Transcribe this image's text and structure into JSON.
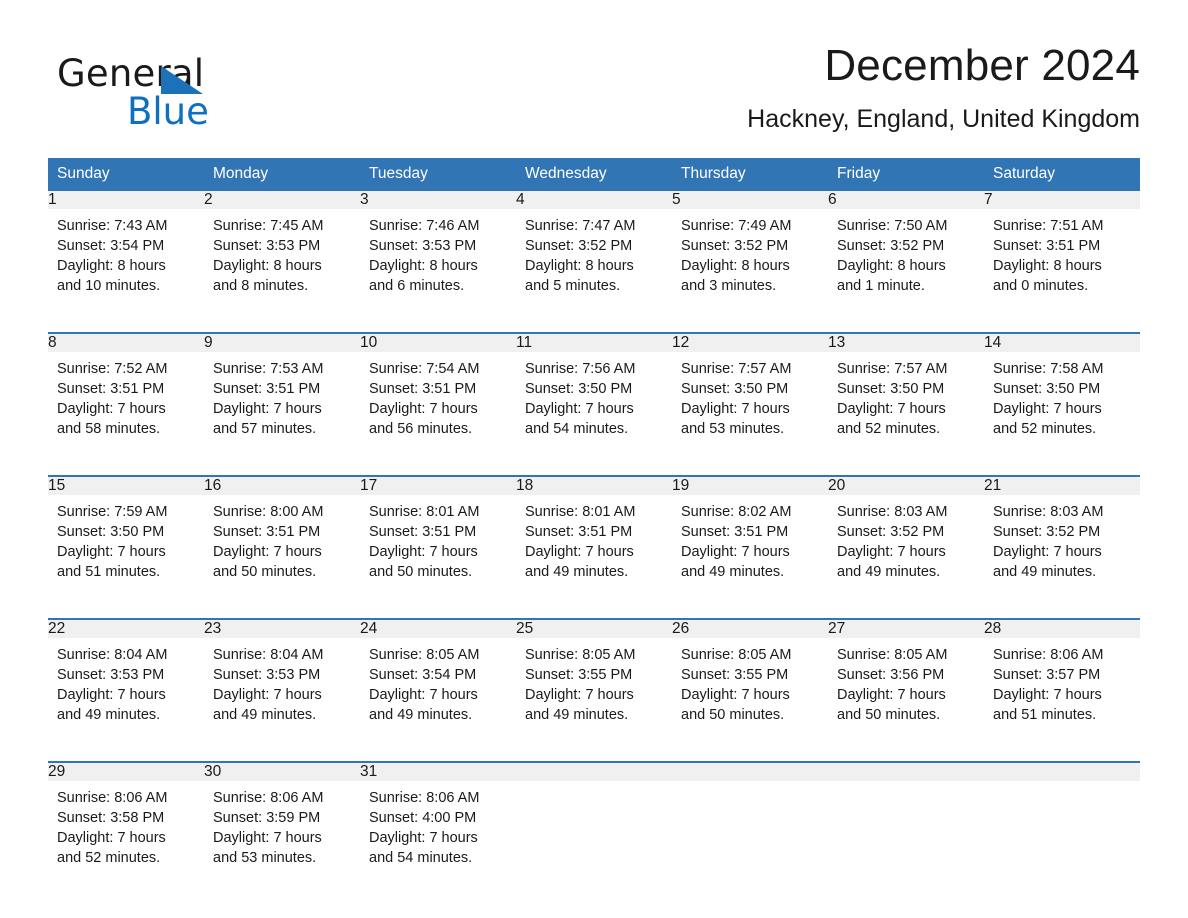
{
  "brand": {
    "name_part1": "General",
    "name_part2": "Blue",
    "triangle_color": "#1c72b8",
    "blue_color": "#0f6fc0"
  },
  "header": {
    "title": "December 2024",
    "subtitle": "Hackney, England, United Kingdom"
  },
  "colors": {
    "header_blue": "#3275b5",
    "daynum_gray": "#f0f0f0",
    "text": "#1a1a1a"
  },
  "calendar": {
    "weekday_headers": [
      "Sunday",
      "Monday",
      "Tuesday",
      "Wednesday",
      "Thursday",
      "Friday",
      "Saturday"
    ],
    "weeks": [
      [
        {
          "day": "1",
          "sunrise": "Sunrise: 7:43 AM",
          "sunset": "Sunset: 3:54 PM",
          "daylight1": "Daylight: 8 hours",
          "daylight2": "and 10 minutes."
        },
        {
          "day": "2",
          "sunrise": "Sunrise: 7:45 AM",
          "sunset": "Sunset: 3:53 PM",
          "daylight1": "Daylight: 8 hours",
          "daylight2": "and 8 minutes."
        },
        {
          "day": "3",
          "sunrise": "Sunrise: 7:46 AM",
          "sunset": "Sunset: 3:53 PM",
          "daylight1": "Daylight: 8 hours",
          "daylight2": "and 6 minutes."
        },
        {
          "day": "4",
          "sunrise": "Sunrise: 7:47 AM",
          "sunset": "Sunset: 3:52 PM",
          "daylight1": "Daylight: 8 hours",
          "daylight2": "and 5 minutes."
        },
        {
          "day": "5",
          "sunrise": "Sunrise: 7:49 AM",
          "sunset": "Sunset: 3:52 PM",
          "daylight1": "Daylight: 8 hours",
          "daylight2": "and 3 minutes."
        },
        {
          "day": "6",
          "sunrise": "Sunrise: 7:50 AM",
          "sunset": "Sunset: 3:52 PM",
          "daylight1": "Daylight: 8 hours",
          "daylight2": "and 1 minute."
        },
        {
          "day": "7",
          "sunrise": "Sunrise: 7:51 AM",
          "sunset": "Sunset: 3:51 PM",
          "daylight1": "Daylight: 8 hours",
          "daylight2": "and 0 minutes."
        }
      ],
      [
        {
          "day": "8",
          "sunrise": "Sunrise: 7:52 AM",
          "sunset": "Sunset: 3:51 PM",
          "daylight1": "Daylight: 7 hours",
          "daylight2": "and 58 minutes."
        },
        {
          "day": "9",
          "sunrise": "Sunrise: 7:53 AM",
          "sunset": "Sunset: 3:51 PM",
          "daylight1": "Daylight: 7 hours",
          "daylight2": "and 57 minutes."
        },
        {
          "day": "10",
          "sunrise": "Sunrise: 7:54 AM",
          "sunset": "Sunset: 3:51 PM",
          "daylight1": "Daylight: 7 hours",
          "daylight2": "and 56 minutes."
        },
        {
          "day": "11",
          "sunrise": "Sunrise: 7:56 AM",
          "sunset": "Sunset: 3:50 PM",
          "daylight1": "Daylight: 7 hours",
          "daylight2": "and 54 minutes."
        },
        {
          "day": "12",
          "sunrise": "Sunrise: 7:57 AM",
          "sunset": "Sunset: 3:50 PM",
          "daylight1": "Daylight: 7 hours",
          "daylight2": "and 53 minutes."
        },
        {
          "day": "13",
          "sunrise": "Sunrise: 7:57 AM",
          "sunset": "Sunset: 3:50 PM",
          "daylight1": "Daylight: 7 hours",
          "daylight2": "and 52 minutes."
        },
        {
          "day": "14",
          "sunrise": "Sunrise: 7:58 AM",
          "sunset": "Sunset: 3:50 PM",
          "daylight1": "Daylight: 7 hours",
          "daylight2": "and 52 minutes."
        }
      ],
      [
        {
          "day": "15",
          "sunrise": "Sunrise: 7:59 AM",
          "sunset": "Sunset: 3:50 PM",
          "daylight1": "Daylight: 7 hours",
          "daylight2": "and 51 minutes."
        },
        {
          "day": "16",
          "sunrise": "Sunrise: 8:00 AM",
          "sunset": "Sunset: 3:51 PM",
          "daylight1": "Daylight: 7 hours",
          "daylight2": "and 50 minutes."
        },
        {
          "day": "17",
          "sunrise": "Sunrise: 8:01 AM",
          "sunset": "Sunset: 3:51 PM",
          "daylight1": "Daylight: 7 hours",
          "daylight2": "and 50 minutes."
        },
        {
          "day": "18",
          "sunrise": "Sunrise: 8:01 AM",
          "sunset": "Sunset: 3:51 PM",
          "daylight1": "Daylight: 7 hours",
          "daylight2": "and 49 minutes."
        },
        {
          "day": "19",
          "sunrise": "Sunrise: 8:02 AM",
          "sunset": "Sunset: 3:51 PM",
          "daylight1": "Daylight: 7 hours",
          "daylight2": "and 49 minutes."
        },
        {
          "day": "20",
          "sunrise": "Sunrise: 8:03 AM",
          "sunset": "Sunset: 3:52 PM",
          "daylight1": "Daylight: 7 hours",
          "daylight2": "and 49 minutes."
        },
        {
          "day": "21",
          "sunrise": "Sunrise: 8:03 AM",
          "sunset": "Sunset: 3:52 PM",
          "daylight1": "Daylight: 7 hours",
          "daylight2": "and 49 minutes."
        }
      ],
      [
        {
          "day": "22",
          "sunrise": "Sunrise: 8:04 AM",
          "sunset": "Sunset: 3:53 PM",
          "daylight1": "Daylight: 7 hours",
          "daylight2": "and 49 minutes."
        },
        {
          "day": "23",
          "sunrise": "Sunrise: 8:04 AM",
          "sunset": "Sunset: 3:53 PM",
          "daylight1": "Daylight: 7 hours",
          "daylight2": "and 49 minutes."
        },
        {
          "day": "24",
          "sunrise": "Sunrise: 8:05 AM",
          "sunset": "Sunset: 3:54 PM",
          "daylight1": "Daylight: 7 hours",
          "daylight2": "and 49 minutes."
        },
        {
          "day": "25",
          "sunrise": "Sunrise: 8:05 AM",
          "sunset": "Sunset: 3:55 PM",
          "daylight1": "Daylight: 7 hours",
          "daylight2": "and 49 minutes."
        },
        {
          "day": "26",
          "sunrise": "Sunrise: 8:05 AM",
          "sunset": "Sunset: 3:55 PM",
          "daylight1": "Daylight: 7 hours",
          "daylight2": "and 50 minutes."
        },
        {
          "day": "27",
          "sunrise": "Sunrise: 8:05 AM",
          "sunset": "Sunset: 3:56 PM",
          "daylight1": "Daylight: 7 hours",
          "daylight2": "and 50 minutes."
        },
        {
          "day": "28",
          "sunrise": "Sunrise: 8:06 AM",
          "sunset": "Sunset: 3:57 PM",
          "daylight1": "Daylight: 7 hours",
          "daylight2": "and 51 minutes."
        }
      ],
      [
        {
          "day": "29",
          "sunrise": "Sunrise: 8:06 AM",
          "sunset": "Sunset: 3:58 PM",
          "daylight1": "Daylight: 7 hours",
          "daylight2": "and 52 minutes."
        },
        {
          "day": "30",
          "sunrise": "Sunrise: 8:06 AM",
          "sunset": "Sunset: 3:59 PM",
          "daylight1": "Daylight: 7 hours",
          "daylight2": "and 53 minutes."
        },
        {
          "day": "31",
          "sunrise": "Sunrise: 8:06 AM",
          "sunset": "Sunset: 4:00 PM",
          "daylight1": "Daylight: 7 hours",
          "daylight2": "and 54 minutes."
        },
        {
          "day": "",
          "sunrise": "",
          "sunset": "",
          "daylight1": "",
          "daylight2": "",
          "empty": true
        },
        {
          "day": "",
          "sunrise": "",
          "sunset": "",
          "daylight1": "",
          "daylight2": "",
          "empty": true
        },
        {
          "day": "",
          "sunrise": "",
          "sunset": "",
          "daylight1": "",
          "daylight2": "",
          "empty": true
        },
        {
          "day": "",
          "sunrise": "",
          "sunset": "",
          "daylight1": "",
          "daylight2": "",
          "empty": true
        }
      ]
    ]
  }
}
